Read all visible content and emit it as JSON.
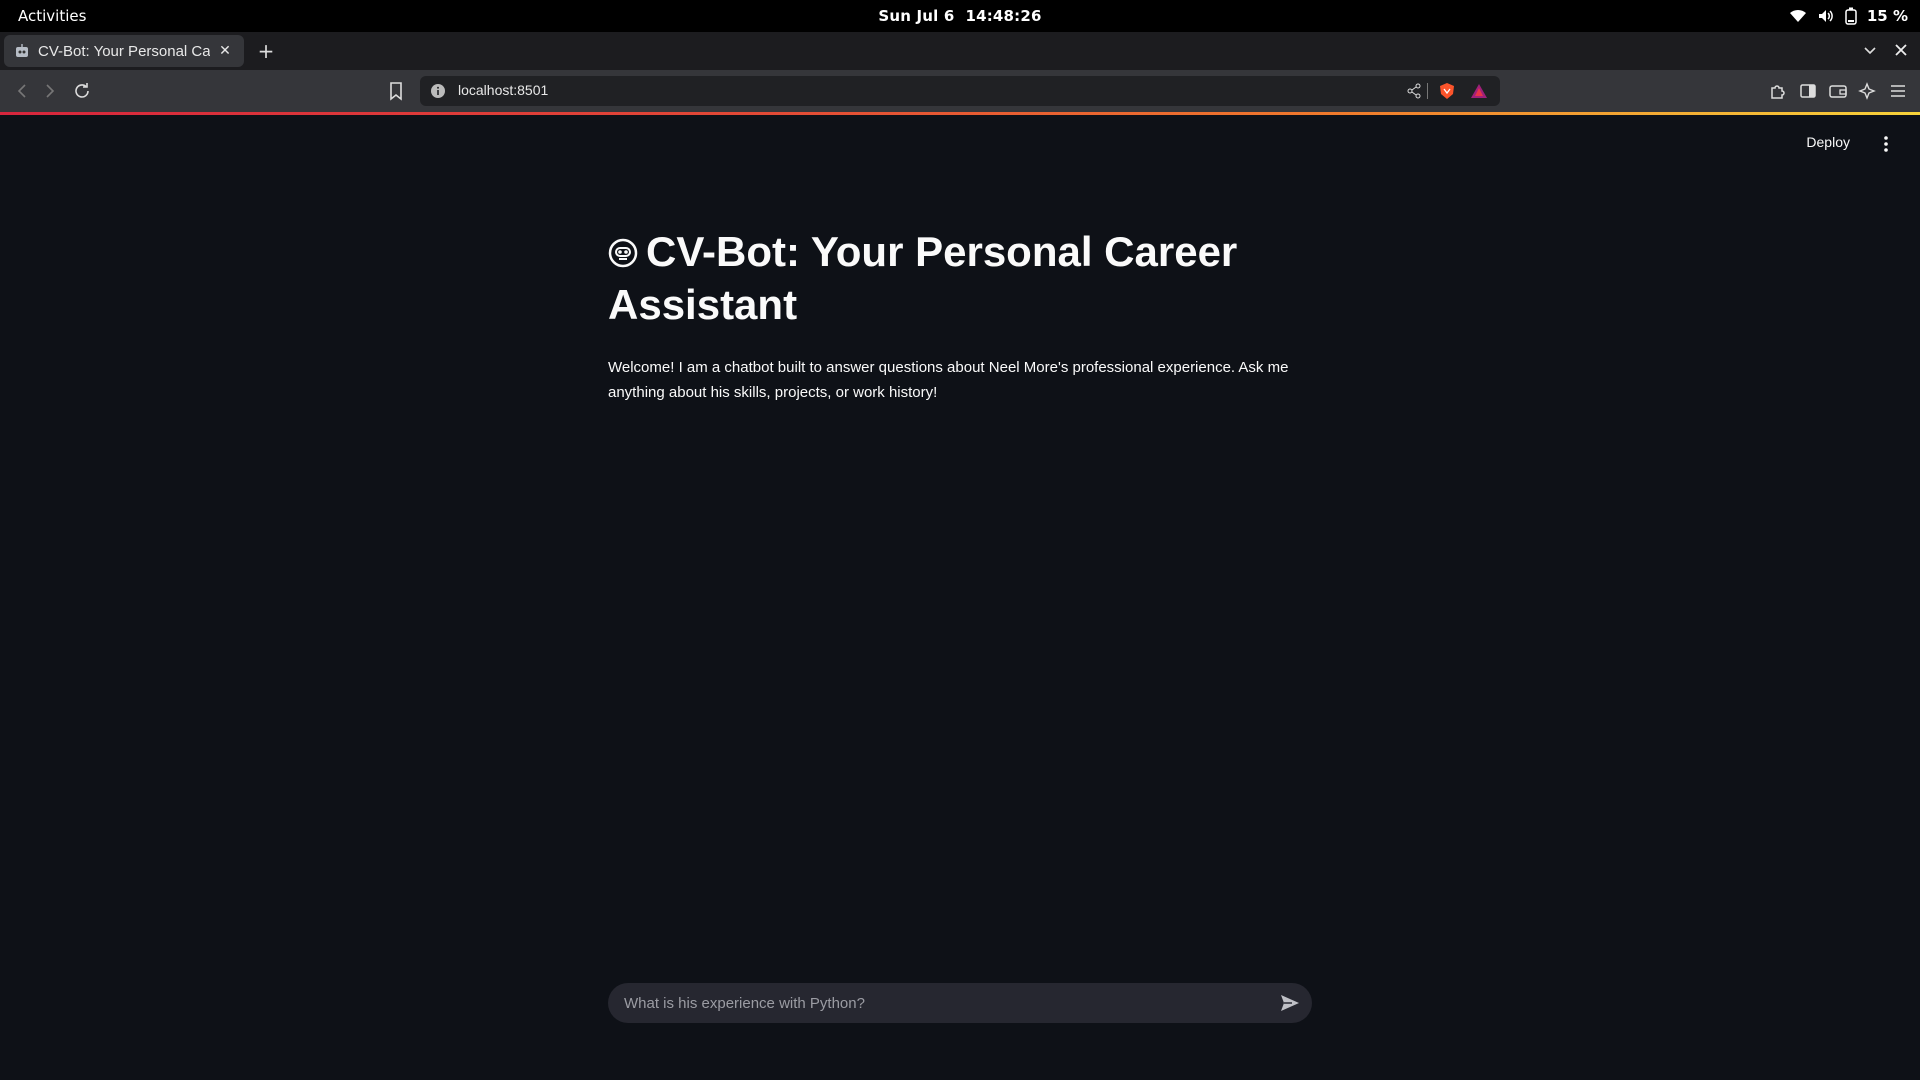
{
  "system": {
    "activities": "Activities",
    "date": "Sun Jul 6",
    "time": "14:48:26",
    "battery": "15 %"
  },
  "browser": {
    "tab_title": "CV-Bot: Your Personal Car",
    "url": "localhost:8501",
    "accent": "#d7263d"
  },
  "app": {
    "deploy_label": "Deploy",
    "title": "CV-Bot: Your Personal Career Assistant",
    "title_icon": "robot-face-icon",
    "intro": "Welcome! I am a chatbot built to answer questions about Neel More's professional experience. Ask me anything about his skills, projects, or work history!",
    "chat_placeholder": "What is his experience with Python?"
  }
}
